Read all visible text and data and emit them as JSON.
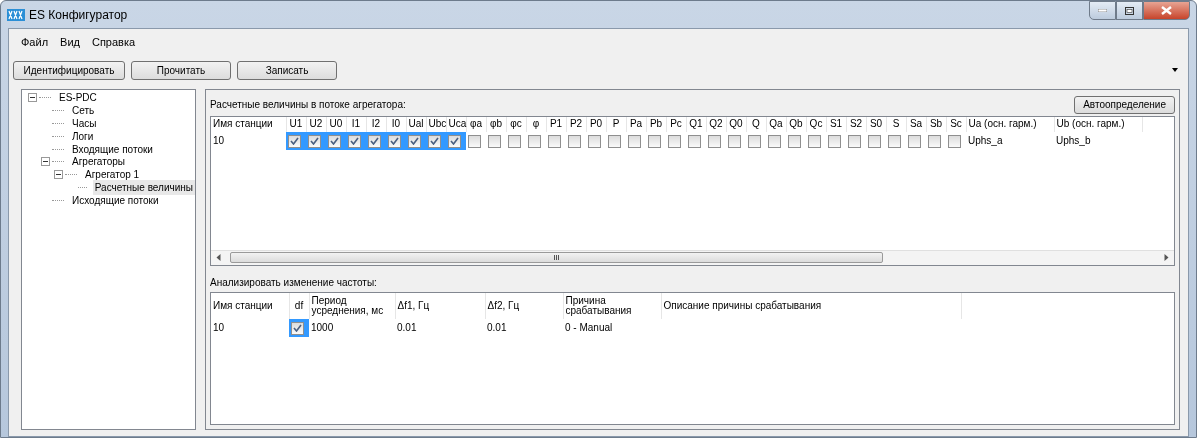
{
  "window": {
    "title": "ES Конфигуратор"
  },
  "menu": [
    "Файл",
    "Вид",
    "Справка"
  ],
  "toolbar": {
    "buttons": [
      "Идентифицировать",
      "Прочитать",
      "Записать"
    ]
  },
  "tree": [
    {
      "label": "ES-PDC",
      "expanded": true,
      "selected": false,
      "children": [
        {
          "label": "Сеть",
          "selected": false
        },
        {
          "label": "Часы",
          "selected": false
        },
        {
          "label": "Логи",
          "selected": false
        },
        {
          "label": "Входящие потоки",
          "selected": false
        },
        {
          "label": "Агрегаторы",
          "expanded": true,
          "selected": false,
          "children": [
            {
              "label": "Агрегатор 1",
              "expanded": true,
              "selected": false,
              "children": [
                {
                  "label": "Расчетные величины",
                  "selected": true
                }
              ]
            }
          ]
        },
        {
          "label": "Исходящие потоки",
          "selected": false
        }
      ]
    }
  ],
  "computed": {
    "title": "Расчетные величины в потоке агрегатора:",
    "auto_button": "Автоопределение",
    "columns": [
      {
        "label": "Имя станции",
        "kind": "text"
      },
      {
        "label": "U1",
        "kind": "check"
      },
      {
        "label": "U2",
        "kind": "check"
      },
      {
        "label": "U0",
        "kind": "check"
      },
      {
        "label": "I1",
        "kind": "check"
      },
      {
        "label": "I2",
        "kind": "check"
      },
      {
        "label": "I0",
        "kind": "check"
      },
      {
        "label": "Ual",
        "kind": "check"
      },
      {
        "label": "Ubc",
        "kind": "check"
      },
      {
        "label": "Uca",
        "kind": "check"
      },
      {
        "label": "φa",
        "kind": "check"
      },
      {
        "label": "φb",
        "kind": "check"
      },
      {
        "label": "φc",
        "kind": "check"
      },
      {
        "label": "φ",
        "kind": "check"
      },
      {
        "label": "P1",
        "kind": "check"
      },
      {
        "label": "P2",
        "kind": "check"
      },
      {
        "label": "P0",
        "kind": "check"
      },
      {
        "label": "P",
        "kind": "check"
      },
      {
        "label": "Pa",
        "kind": "check"
      },
      {
        "label": "Pb",
        "kind": "check"
      },
      {
        "label": "Pc",
        "kind": "check"
      },
      {
        "label": "Q1",
        "kind": "check"
      },
      {
        "label": "Q2",
        "kind": "check"
      },
      {
        "label": "Q0",
        "kind": "check"
      },
      {
        "label": "Q",
        "kind": "check"
      },
      {
        "label": "Qa",
        "kind": "check"
      },
      {
        "label": "Qb",
        "kind": "check"
      },
      {
        "label": "Qc",
        "kind": "check"
      },
      {
        "label": "S1",
        "kind": "check"
      },
      {
        "label": "S2",
        "kind": "check"
      },
      {
        "label": "S0",
        "kind": "check"
      },
      {
        "label": "S",
        "kind": "check"
      },
      {
        "label": "Sa",
        "kind": "check"
      },
      {
        "label": "Sb",
        "kind": "check"
      },
      {
        "label": "Sc",
        "kind": "check"
      },
      {
        "label": "Ua (осн. гарм.)",
        "kind": "wide"
      },
      {
        "label": "Ub (осн. гарм.)",
        "kind": "wide"
      }
    ],
    "rows": [
      {
        "cells": [
          {
            "text": "10",
            "selected": false
          },
          {
            "checked": true,
            "selected": true
          },
          {
            "checked": true,
            "selected": true
          },
          {
            "checked": true,
            "selected": true
          },
          {
            "checked": true,
            "selected": true
          },
          {
            "checked": true,
            "selected": true
          },
          {
            "checked": true,
            "selected": true
          },
          {
            "checked": true,
            "selected": true
          },
          {
            "checked": true,
            "selected": true
          },
          {
            "checked": true,
            "selected": true
          },
          {
            "checked": false,
            "selected": false
          },
          {
            "checked": false,
            "selected": false
          },
          {
            "checked": false,
            "selected": false
          },
          {
            "checked": false,
            "selected": false
          },
          {
            "checked": false,
            "selected": false
          },
          {
            "checked": false,
            "selected": false
          },
          {
            "checked": false,
            "selected": false
          },
          {
            "checked": false,
            "selected": false
          },
          {
            "checked": false,
            "selected": false
          },
          {
            "checked": false,
            "selected": false
          },
          {
            "checked": false,
            "selected": false
          },
          {
            "checked": false,
            "selected": false
          },
          {
            "checked": false,
            "selected": false
          },
          {
            "checked": false,
            "selected": false
          },
          {
            "checked": false,
            "selected": false
          },
          {
            "checked": false,
            "selected": false
          },
          {
            "checked": false,
            "selected": false
          },
          {
            "checked": false,
            "selected": false
          },
          {
            "checked": false,
            "selected": false
          },
          {
            "checked": false,
            "selected": false
          },
          {
            "checked": false,
            "selected": false
          },
          {
            "checked": false,
            "selected": false
          },
          {
            "checked": false,
            "selected": false
          },
          {
            "checked": false,
            "selected": false
          },
          {
            "checked": false,
            "selected": false
          },
          {
            "text": "Uphs_a",
            "selected": false
          },
          {
            "text": "Uphs_b",
            "selected": false
          }
        ]
      }
    ],
    "scrollbar_grip": "III"
  },
  "frequency": {
    "title": "Анализировать изменение частоты:",
    "columns": [
      {
        "label": "Имя станции",
        "kind": "text"
      },
      {
        "label": "df",
        "kind": "check"
      },
      {
        "label": "Период усреднения, мс",
        "kind": "text"
      },
      {
        "label": "Δf1, Гц",
        "kind": "text"
      },
      {
        "label": "Δf2, Гц",
        "kind": "text"
      },
      {
        "label": "Причина срабатывания",
        "kind": "text"
      },
      {
        "label": "Описание причины срабатывания",
        "kind": "text"
      }
    ],
    "rows": [
      {
        "cells": [
          {
            "text": "10",
            "selected": false
          },
          {
            "checked": true,
            "selected": true
          },
          {
            "text": "1000",
            "selected": false
          },
          {
            "text": "0.01",
            "selected": false
          },
          {
            "text": "0.01",
            "selected": false
          },
          {
            "text": "0 - Manual",
            "selected": false
          }
        ]
      }
    ]
  }
}
